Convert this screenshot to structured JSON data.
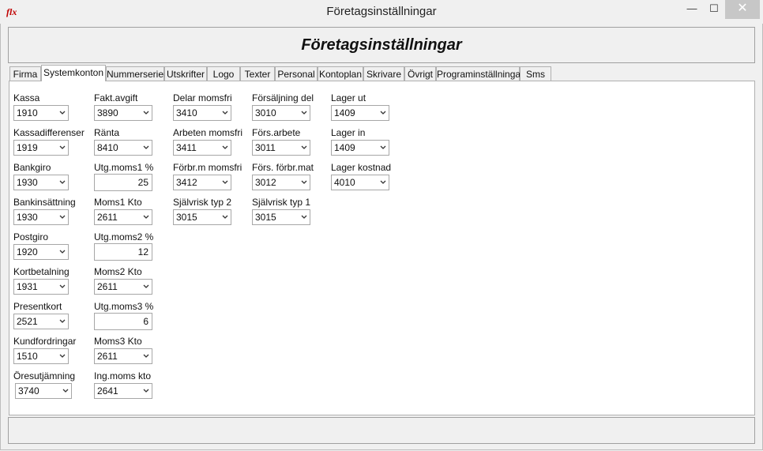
{
  "window": {
    "title": "Företagsinställningar",
    "icon": "flx",
    "min": "—",
    "max": "☐",
    "close": "✕"
  },
  "header": {
    "title": "Företagsinställningar"
  },
  "tabs": [
    {
      "label": "Firma"
    },
    {
      "label": "Systemkonton",
      "active": true
    },
    {
      "label": "Nummerserier"
    },
    {
      "label": "Utskrifter"
    },
    {
      "label": "Logo"
    },
    {
      "label": "Texter"
    },
    {
      "label": "Personal"
    },
    {
      "label": "Kontoplan"
    },
    {
      "label": "Skrivare"
    },
    {
      "label": "Övrigt"
    },
    {
      "label": "Programinställningar"
    },
    {
      "label": "Sms"
    }
  ],
  "fields": {
    "kassa": {
      "label": "Kassa",
      "value": "1910"
    },
    "kassadifferenser": {
      "label": "Kassadifferenser",
      "value": "1919"
    },
    "bankgiro": {
      "label": "Bankgiro",
      "value": "1930"
    },
    "bankinsattning": {
      "label": "Bankinsättning",
      "value": "1930"
    },
    "postgiro": {
      "label": "Postgiro",
      "value": "1920"
    },
    "kortbetalning": {
      "label": "Kortbetalning",
      "value": "1931"
    },
    "presentkort": {
      "label": "Presentkort",
      "value": "2521"
    },
    "kundfordringar": {
      "label": "Kundfordringar",
      "value": "1510"
    },
    "oresutjamning": {
      "label": "Öresutjämning",
      "value": "3740"
    },
    "fakt_avgift": {
      "label": "Fakt.avgift",
      "value": "3890"
    },
    "ranta": {
      "label": "Ränta",
      "value": "8410"
    },
    "utg_moms1": {
      "label": "Utg.moms1 %",
      "value": "25"
    },
    "moms1_kto": {
      "label": "Moms1 Kto",
      "value": "2611"
    },
    "utg_moms2": {
      "label": "Utg.moms2 %",
      "value": "12"
    },
    "moms2_kto": {
      "label": "Moms2 Kto",
      "value": "2611"
    },
    "utg_moms3": {
      "label": "Utg.moms3 %",
      "value": "6"
    },
    "moms3_kto": {
      "label": "Moms3 Kto",
      "value": "2611"
    },
    "ing_moms_kto": {
      "label": "Ing.moms kto",
      "value": "2641"
    },
    "delar_momsfri": {
      "label": "Delar momsfri",
      "value": "3410"
    },
    "arbeten_momsfri": {
      "label": "Arbeten momsfri",
      "value": "3411"
    },
    "forbr_m_momsfri": {
      "label": "Förbr.m momsfri",
      "value": "3412"
    },
    "sjalvrisk_typ2": {
      "label": "Självrisk typ 2",
      "value": "3015"
    },
    "forsaljning_del": {
      "label": "Försäljning del",
      "value": "3010"
    },
    "fors_arbete": {
      "label": "Förs.arbete",
      "value": "3011"
    },
    "fors_forbr_mat": {
      "label": "Förs. förbr.mat",
      "value": "3012"
    },
    "sjalvrisk_typ1": {
      "label": "Självrisk typ 1",
      "value": "3015"
    },
    "lager_ut": {
      "label": "Lager ut",
      "value": "1409"
    },
    "lager_in": {
      "label": "Lager in",
      "value": "1409"
    },
    "lager_kostnad": {
      "label": "Lager kostnad",
      "value": "4010"
    }
  }
}
